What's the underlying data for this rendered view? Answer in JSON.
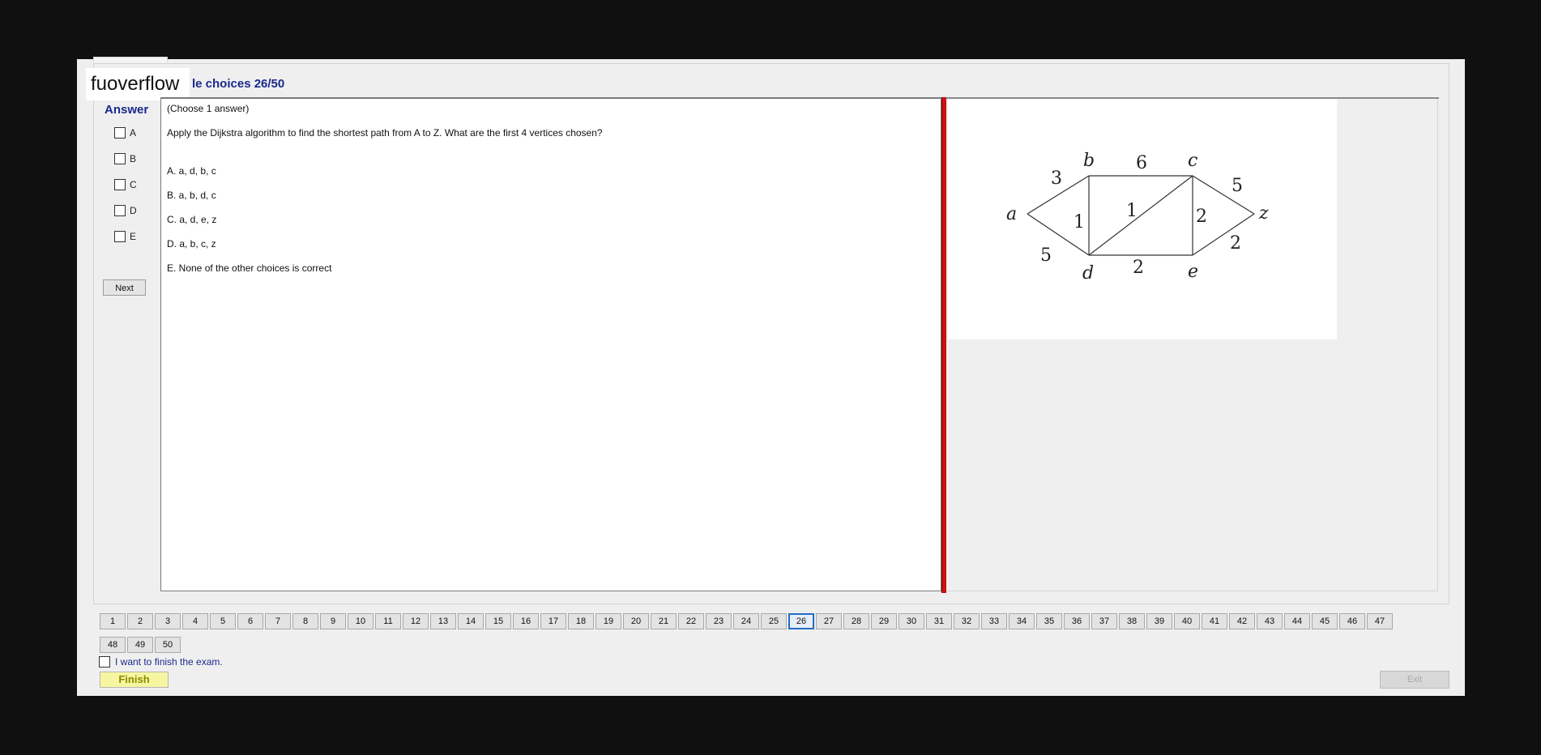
{
  "brand": "fuoverflow",
  "section_title": "le choices 26/50",
  "answer_panel": {
    "title": "Answer",
    "options": [
      "A",
      "B",
      "C",
      "D",
      "E"
    ],
    "next_label": "Next"
  },
  "question": {
    "instruction": "(Choose 1 answer)",
    "text": "Apply the Dijkstra algorithm to find the shortest path from A to Z. What are the first 4 vertices chosen?",
    "choices": [
      "A.  a, d, b, c",
      "B.  a, b, d, c",
      "C.  a, d, e, z",
      "D.  a, b, c, z",
      "E.  None of the other choices is correct"
    ]
  },
  "graph": {
    "vertices": [
      "a",
      "b",
      "c",
      "d",
      "e",
      "z"
    ],
    "edges": [
      {
        "from": "a",
        "to": "b",
        "weight": "3"
      },
      {
        "from": "a",
        "to": "d",
        "weight": "5"
      },
      {
        "from": "b",
        "to": "c",
        "weight": "6"
      },
      {
        "from": "b",
        "to": "d",
        "weight": "1"
      },
      {
        "from": "d",
        "to": "c",
        "weight": "1"
      },
      {
        "from": "c",
        "to": "e",
        "weight": "2"
      },
      {
        "from": "d",
        "to": "e",
        "weight": "2"
      },
      {
        "from": "c",
        "to": "z",
        "weight": "5"
      },
      {
        "from": "e",
        "to": "z",
        "weight": "2"
      }
    ]
  },
  "navigation": {
    "row1": [
      "1",
      "2",
      "3",
      "4",
      "5",
      "6",
      "7",
      "8",
      "9",
      "10",
      "11",
      "12",
      "13",
      "14",
      "15",
      "16",
      "17",
      "18",
      "19",
      "20",
      "21",
      "22",
      "23",
      "24",
      "25",
      "26",
      "27",
      "28",
      "29",
      "30",
      "31",
      "32",
      "33",
      "34",
      "35",
      "36",
      "37",
      "38",
      "39",
      "40",
      "41",
      "42",
      "43",
      "44",
      "45",
      "46",
      "47"
    ],
    "row2": [
      "48",
      "49",
      "50"
    ],
    "current": "26"
  },
  "finish": {
    "checkbox_label": "I want to finish the exam.",
    "button_label": "Finish"
  },
  "exit_label": "Exit",
  "colors": {
    "title_blue": "#1a2a8c",
    "divider_red": "#d01010",
    "current_border": "#1f6fc6",
    "finish_bg": "#f6f6a0"
  }
}
